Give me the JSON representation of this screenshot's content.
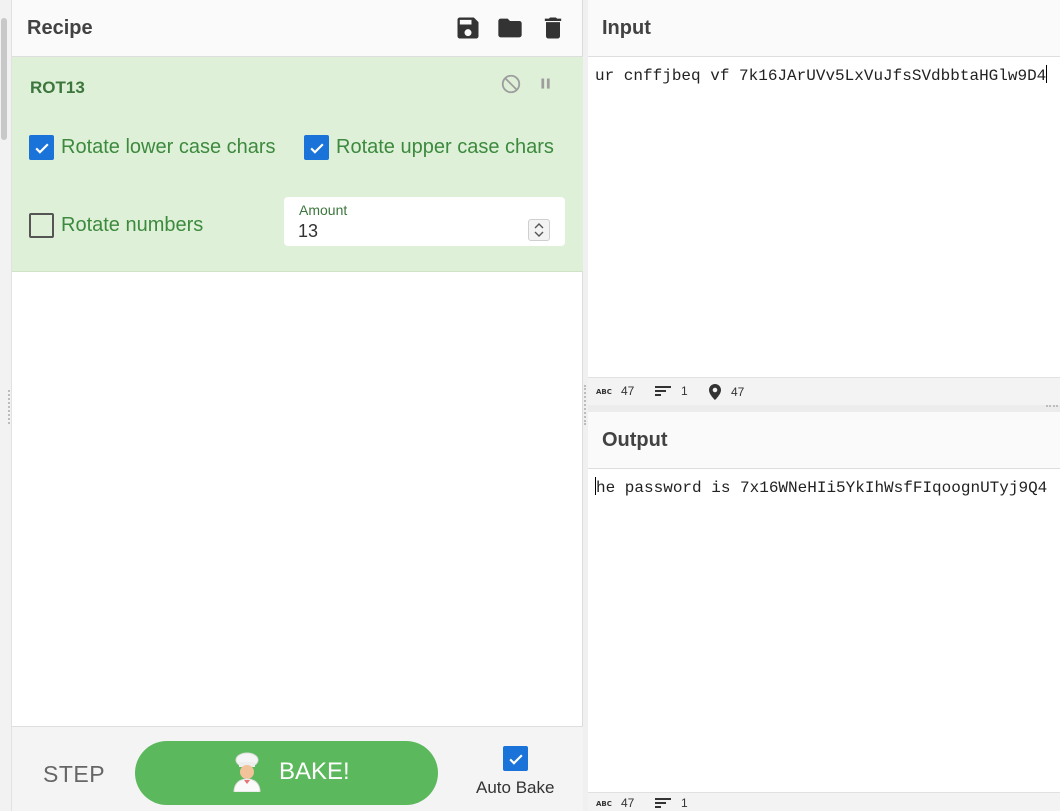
{
  "recipe": {
    "title": "Recipe",
    "toolbar": {
      "save_icon": "save-icon",
      "load_icon": "folder-icon",
      "clear_icon": "trash-icon"
    },
    "operation": {
      "name": "ROT13",
      "controls": {
        "disable_icon": "disable-icon",
        "breakpoint_icon": "pause-icon"
      },
      "options": {
        "rotate_lower": {
          "label": "Rotate lower case chars",
          "checked": true
        },
        "rotate_upper": {
          "label": "Rotate upper case chars",
          "checked": true
        },
        "rotate_numbers": {
          "label": "Rotate numbers",
          "checked": false
        }
      },
      "amount": {
        "label": "Amount",
        "value": "13"
      }
    }
  },
  "controls": {
    "step_label": "STEP",
    "bake_label": "BAKE!",
    "auto_bake_label": "Auto Bake",
    "auto_bake_checked": true
  },
  "input": {
    "title": "Input",
    "text": "ur cnffjbeq vf 7k16JArUVv5LxVuJfsSVdbbtaHGlw9D4",
    "status": {
      "length": "47",
      "lines": "1",
      "position": "47"
    }
  },
  "output": {
    "title": "Output",
    "text": "he password is 7x16WNeHIi5YkIhWsfFIqoognUTyj9Q4",
    "status": {
      "length": "47",
      "lines": "1"
    }
  },
  "colors": {
    "accent_green": "#5cb85c",
    "operation_bg": "#dff0d8",
    "operation_text": "#3c763d",
    "checkbox_blue": "#1a73d9"
  }
}
